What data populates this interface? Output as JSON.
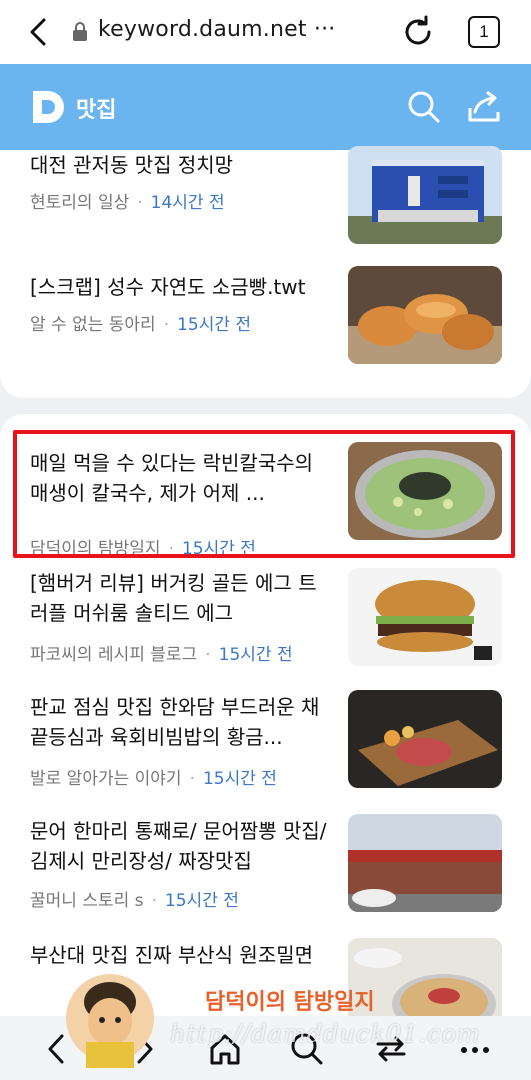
{
  "browser": {
    "url": "keyword.daum.net ···",
    "tab_count": "1"
  },
  "header": {
    "logo_letter": "D",
    "title": "맛집"
  },
  "items_top": [
    {
      "title": "대전 관저동 맛집 정치망",
      "source": "현토리의 일상",
      "time": "14시간 전",
      "thumb": "blue-building"
    },
    {
      "title": "[스크랩] 성수 자연도 소금빵.twt",
      "source": "알 수 없는 동아리",
      "time": "15시간 전",
      "thumb": "salt-bread"
    }
  ],
  "items_bottom": [
    {
      "title": "매일 먹을 수 있다는 락빈칼국수의 매생이 칼국수, 제가 어제 ...",
      "source": "담덕이의 탐방일지",
      "time": "15시간 전",
      "thumb": "noodle-soup",
      "highlighted": true
    },
    {
      "title": "[햄버거 리뷰] 버거킹 골든 에그 트러플 머쉬룸 솔티드 에그",
      "source": "파코씨의 레시피 블로그",
      "time": "15시간 전",
      "thumb": "burger"
    },
    {
      "title": "판교 점심 맛집 한와담 부드러운 채끝등심과 육회비빔밥의 황금...",
      "source": "발로 알아가는 이야기",
      "time": "15시간 전",
      "thumb": "grilled-beef"
    },
    {
      "title": "문어 한마리 통째로/ 문어짬뽕 맛집/김제시 만리장성/ 짜장맛집",
      "source": "꿀머니 스토리 s",
      "time": "15시간 전",
      "thumb": "restaurant-front"
    },
    {
      "title": "부산대 맛집 진짜 부산식 원조밀면",
      "source": "",
      "time": "",
      "thumb": "cold-noodles"
    }
  ],
  "overlay": {
    "signature": "담덕이의 탐방일지",
    "watermark": "http://damdduck01.com"
  },
  "colors": {
    "header_bg": "#6ab5ef",
    "time_text": "#3b78c8",
    "highlight_border": "#e8121a"
  }
}
